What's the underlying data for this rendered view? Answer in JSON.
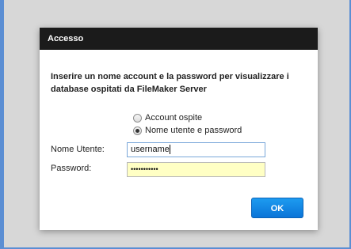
{
  "dialog": {
    "title": "Accesso",
    "instructions": "Inserire un nome account e la password per visualizzare i database ospitati da FileMaker Server",
    "options": [
      {
        "label": "Account ospite",
        "selected": false
      },
      {
        "label": "Nome utente e password",
        "selected": true
      }
    ],
    "username_label": "Nome Utente:",
    "username_value": "username",
    "password_label": "Password:",
    "password_value": "•••••••••••",
    "ok_label": "OK"
  },
  "colors": {
    "background": "#5b8ed3",
    "titlebar": "#1b1b1b",
    "ok_button": "#1d9bf0",
    "password_fill": "#ffffc4"
  }
}
